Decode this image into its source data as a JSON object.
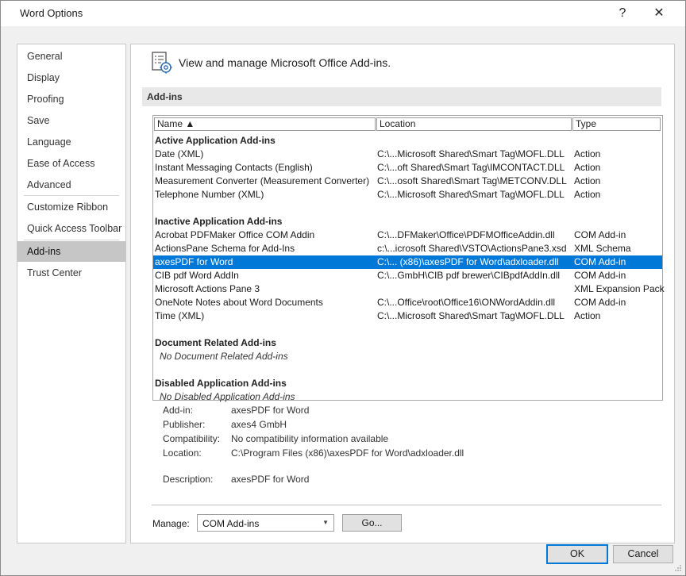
{
  "window": {
    "title": "Word Options",
    "help": "?",
    "close": "✕"
  },
  "nav": {
    "items": [
      {
        "label": "General"
      },
      {
        "label": "Display"
      },
      {
        "label": "Proofing"
      },
      {
        "label": "Save"
      },
      {
        "label": "Language"
      },
      {
        "label": "Ease of Access"
      },
      {
        "label": "Advanced"
      },
      {
        "label": "Customize Ribbon"
      },
      {
        "label": "Quick Access Toolbar"
      },
      {
        "label": "Add-ins",
        "selected": true
      },
      {
        "label": "Trust Center"
      }
    ]
  },
  "main": {
    "header": "View and manage Microsoft Office Add-ins.",
    "section": "Add-ins",
    "columns": {
      "name": "Name ▲",
      "location": "Location",
      "type": "Type"
    },
    "groups": {
      "active": "Active Application Add-ins",
      "inactive": "Inactive Application Add-ins",
      "document": "Document Related Add-ins",
      "document_empty": "No Document Related Add-ins",
      "disabled": "Disabled Application Add-ins",
      "disabled_empty": "No Disabled Application Add-ins"
    },
    "active_rows": [
      {
        "name": "Date (XML)",
        "location": "C:\\...Microsoft Shared\\Smart Tag\\MOFL.DLL",
        "type": "Action"
      },
      {
        "name": "Instant Messaging Contacts (English)",
        "location": "C:\\...oft Shared\\Smart Tag\\IMCONTACT.DLL",
        "type": "Action"
      },
      {
        "name": "Measurement Converter (Measurement Converter)",
        "location": "C:\\...osoft Shared\\Smart Tag\\METCONV.DLL",
        "type": "Action"
      },
      {
        "name": "Telephone Number (XML)",
        "location": "C:\\...Microsoft Shared\\Smart Tag\\MOFL.DLL",
        "type": "Action"
      }
    ],
    "inactive_rows": [
      {
        "name": "Acrobat PDFMaker Office COM Addin",
        "location": "C:\\...DFMaker\\Office\\PDFMOfficeAddin.dll",
        "type": "COM Add-in"
      },
      {
        "name": "ActionsPane Schema for Add-Ins",
        "location": "c:\\...icrosoft Shared\\VSTO\\ActionsPane3.xsd",
        "type": "XML Schema"
      },
      {
        "name": "axesPDF for Word",
        "location": "C:\\... (x86)\\axesPDF for Word\\adxloader.dll",
        "type": "COM Add-in"
      },
      {
        "name": "CIB pdf Word AddIn",
        "location": "C:\\...GmbH\\CIB pdf brewer\\CIBpdfAddIn.dll",
        "type": "COM Add-in"
      },
      {
        "name": "Microsoft Actions Pane 3",
        "location": "",
        "type": "XML Expansion Pack"
      },
      {
        "name": "OneNote Notes about Word Documents",
        "location": "C:\\...Office\\root\\Office16\\ONWordAddin.dll",
        "type": "COM Add-in"
      },
      {
        "name": "Time (XML)",
        "location": "C:\\...Microsoft Shared\\Smart Tag\\MOFL.DLL",
        "type": "Action"
      }
    ],
    "details": {
      "addin_label": "Add-in:",
      "addin": "axesPDF for Word",
      "publisher_label": "Publisher:",
      "publisher": "axes4 GmbH",
      "compat_label": "Compatibility:",
      "compat": "No compatibility information available",
      "location_label": "Location:",
      "location": "C:\\Program Files (x86)\\axesPDF for Word\\adxloader.dll",
      "desc_label": "Description:",
      "desc": "axesPDF for Word"
    },
    "manage_label": "Manage:",
    "manage_value": "COM Add-ins",
    "go": "Go..."
  },
  "buttons": {
    "ok": "OK",
    "cancel": "Cancel"
  },
  "colors": {
    "selection": "#0078d7"
  }
}
